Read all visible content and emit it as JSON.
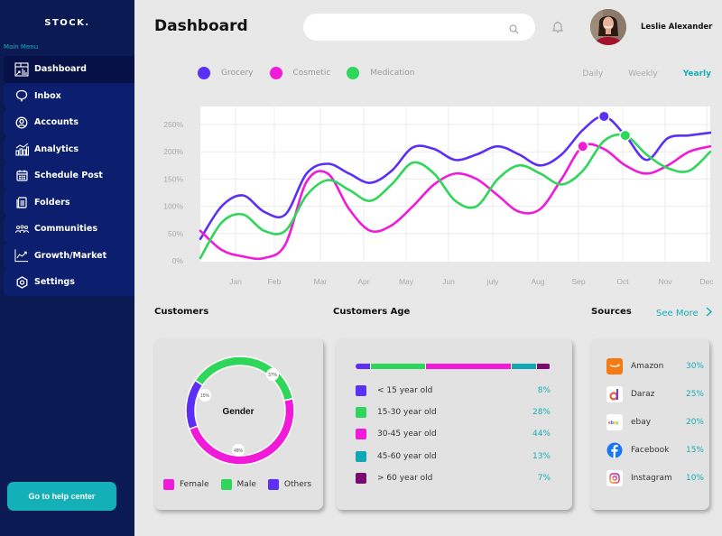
{
  "sidebar": {
    "logo": "STOCK.",
    "menu_title": "Main Menu",
    "items": [
      {
        "label": "Dashboard",
        "icon": "dashboard-icon",
        "active": true
      },
      {
        "label": "Inbox",
        "icon": "chat-bubble-icon"
      },
      {
        "label": "Accounts",
        "icon": "user-circle-icon"
      },
      {
        "label": "Analytics",
        "icon": "analytics-icon"
      },
      {
        "label": "Schedule Post",
        "icon": "calendar-icon"
      },
      {
        "label": "Folders",
        "icon": "folder-icon"
      },
      {
        "label": "Communities",
        "icon": "people-icon"
      },
      {
        "label": "Growth/Market",
        "icon": "trend-chart-icon"
      },
      {
        "label": "Settings",
        "icon": "settings-icon"
      }
    ],
    "help_button": "Go to help center"
  },
  "header": {
    "title": "Dashboard",
    "search_placeholder": "",
    "user_name": "Leslie Alexander"
  },
  "chart_controls": {
    "periods": [
      "Daily",
      "Weekly",
      "Yearly"
    ],
    "active_period": "Yearly"
  },
  "colors": {
    "grocery": "#5b2ff5",
    "cosmetic": "#f01ad8",
    "medication": "#2ed65a",
    "accent": "#14b0b8",
    "sidebar_bg": "#0b1a52",
    "age_45_60": "#10a8b4",
    "age_60_plus": "#7a0a72"
  },
  "chart_data": {
    "type": "line",
    "title": "",
    "xlabel": "",
    "ylabel": "",
    "ylim": [
      0,
      250
    ],
    "yticks": [
      "0%",
      "50%",
      "100%",
      "150%",
      "200%",
      "250%"
    ],
    "ytick_values": [
      0,
      50,
      100,
      150,
      200,
      250
    ],
    "categories": [
      "Jan",
      "Feb",
      "Mar",
      "Apr",
      "May",
      "Jun",
      "july",
      "Aug",
      "Sep",
      "Oct",
      "Nov",
      "Dec"
    ],
    "grid": true,
    "legend_position": "top-left",
    "x": [
      0,
      0.5,
      1,
      1.5,
      2,
      2.5,
      3,
      3.5,
      4,
      4.5,
      5,
      5.5,
      6,
      6.5,
      7,
      7.5,
      8,
      8.5,
      9,
      9.5,
      10,
      10.5,
      11,
      11.5,
      12
    ],
    "series": [
      {
        "name": "Grocery",
        "values": [
          40,
          100,
          120,
          90,
          85,
          160,
          178,
          160,
          143,
          165,
          208,
          205,
          185,
          195,
          210,
          195,
          175,
          195,
          240,
          265,
          230,
          185,
          225,
          230,
          235
        ],
        "highlight_index": 19
      },
      {
        "name": "Cosmetic",
        "values": [
          55,
          20,
          8,
          5,
          30,
          145,
          160,
          95,
          55,
          65,
          100,
          140,
          160,
          150,
          120,
          90,
          95,
          150,
          210,
          205,
          175,
          160,
          175,
          200,
          210
        ],
        "highlight_index": 18
      },
      {
        "name": "Medication",
        "values": [
          5,
          70,
          85,
          55,
          55,
          120,
          148,
          130,
          110,
          140,
          180,
          160,
          110,
          100,
          150,
          175,
          160,
          140,
          165,
          220,
          230,
          195,
          170,
          165,
          200
        ],
        "highlight_index": 20
      }
    ]
  },
  "sections": {
    "customers": "Customers",
    "customers_age": "Customers Age",
    "sources": "Sources",
    "see_more": "See More"
  },
  "gender": {
    "center_label": "Gender",
    "slices": [
      {
        "name": "Female",
        "value": 48,
        "label": "48%",
        "color": "#f01ad8"
      },
      {
        "name": "Male",
        "value": 37,
        "label": "37%",
        "color": "#2ed65a"
      },
      {
        "name": "Others",
        "value": 15,
        "label": "15%",
        "color": "#5b2ff5"
      }
    ]
  },
  "age": {
    "rows": [
      {
        "label": "<  15 year old",
        "value": "8%",
        "pct": 8,
        "color": "#5b2ff5"
      },
      {
        "label": "15-30 year old",
        "value": "28%",
        "pct": 28,
        "color": "#2ed65a"
      },
      {
        "label": "30-45 year old",
        "value": "44%",
        "pct": 44,
        "color": "#f01ad8"
      },
      {
        "label": "45-60 year old",
        "value": "13%",
        "pct": 13,
        "color": "#10a8b4"
      },
      {
        "label": "> 60 year old",
        "value": "7%",
        "pct": 7,
        "color": "#7a0a72"
      }
    ]
  },
  "sources": {
    "rows": [
      {
        "name": "Amazon",
        "value": "30%",
        "icon": "amazon-icon"
      },
      {
        "name": "Daraz",
        "value": "25%",
        "icon": "daraz-icon"
      },
      {
        "name": "ebay",
        "value": "20%",
        "icon": "ebay-icon"
      },
      {
        "name": "Facebook",
        "value": "15%",
        "icon": "facebook-icon"
      },
      {
        "name": "Instagram",
        "value": "10%",
        "icon": "instagram-icon"
      }
    ]
  }
}
